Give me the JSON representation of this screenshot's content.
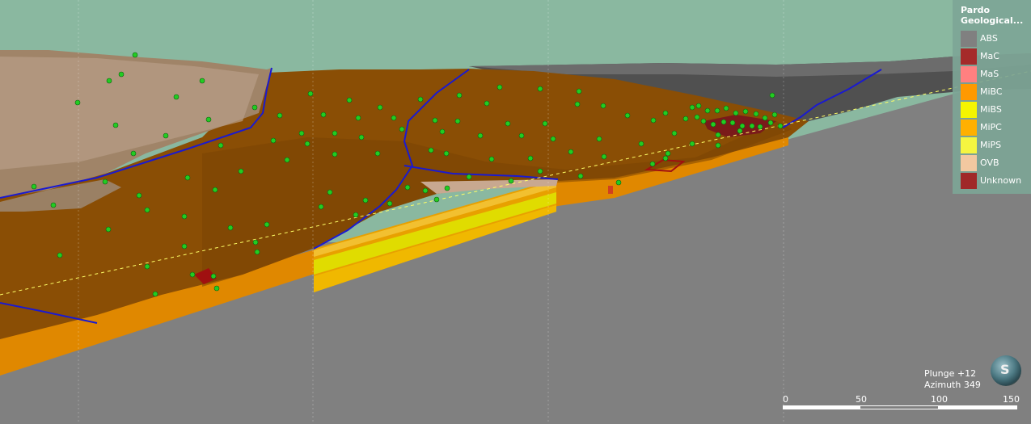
{
  "legend": {
    "title_line1": "Pardo",
    "title_line2": "Geological...",
    "items": [
      {
        "label": "ABS",
        "color": "#808080"
      },
      {
        "label": "MaC",
        "color": "#a52a2a"
      },
      {
        "label": "MaS",
        "color": "#ff8080"
      },
      {
        "label": "MiBC",
        "color": "#ff9900"
      },
      {
        "label": "MiBS",
        "color": "#f5f500"
      },
      {
        "label": "MiPC",
        "color": "#ffb000"
      },
      {
        "label": "MiPS",
        "color": "#f5f540"
      },
      {
        "label": "OVB",
        "color": "#f2c8a0"
      },
      {
        "label": "Unknown",
        "color": "#a02828"
      }
    ]
  },
  "view": {
    "plunge": "Plunge +12",
    "azimuth": "Azimuth 349"
  },
  "scale": {
    "ticks": [
      "0",
      "50",
      "100",
      "150"
    ]
  },
  "compass": {
    "icon": "compass-logo-icon",
    "glyph": "S"
  },
  "colors": {
    "sky": "#8ab8a0",
    "floor": "#808080",
    "bedrock_surface": "#8a4e05",
    "drillhole_marker": "#22cc22",
    "fault_line": "#1a1ad0",
    "section_line": "#ffff66"
  }
}
